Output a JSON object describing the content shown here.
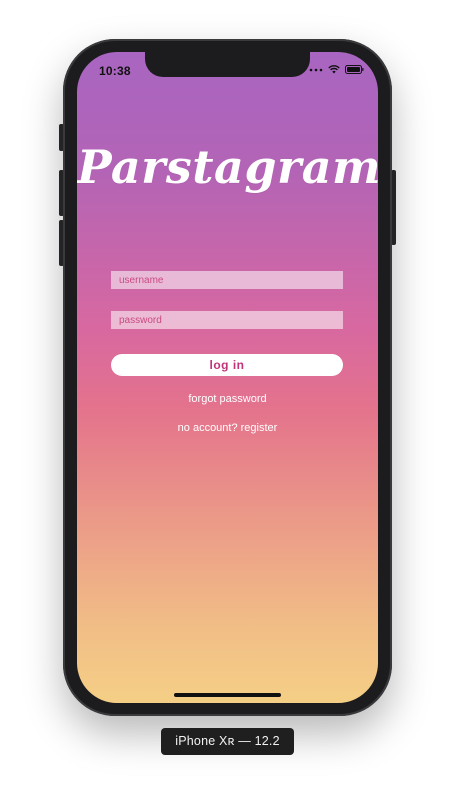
{
  "status_bar": {
    "time": "10:38",
    "icons": [
      "signal-dots-icon",
      "wifi-icon",
      "battery-icon"
    ]
  },
  "app": {
    "logo_text": "Parstagram",
    "username_placeholder": "username",
    "password_placeholder": "password",
    "login_label": "log in",
    "forgot_password_label": "forgot password",
    "register_label": "no account? register"
  },
  "simulator": {
    "device_label": "iPhone Xʀ — 12.2"
  },
  "colors": {
    "gradient_top": "#a865c1",
    "gradient_middle": "#e4738c",
    "gradient_bottom": "#f5cf86",
    "accent": "#c0347a"
  }
}
